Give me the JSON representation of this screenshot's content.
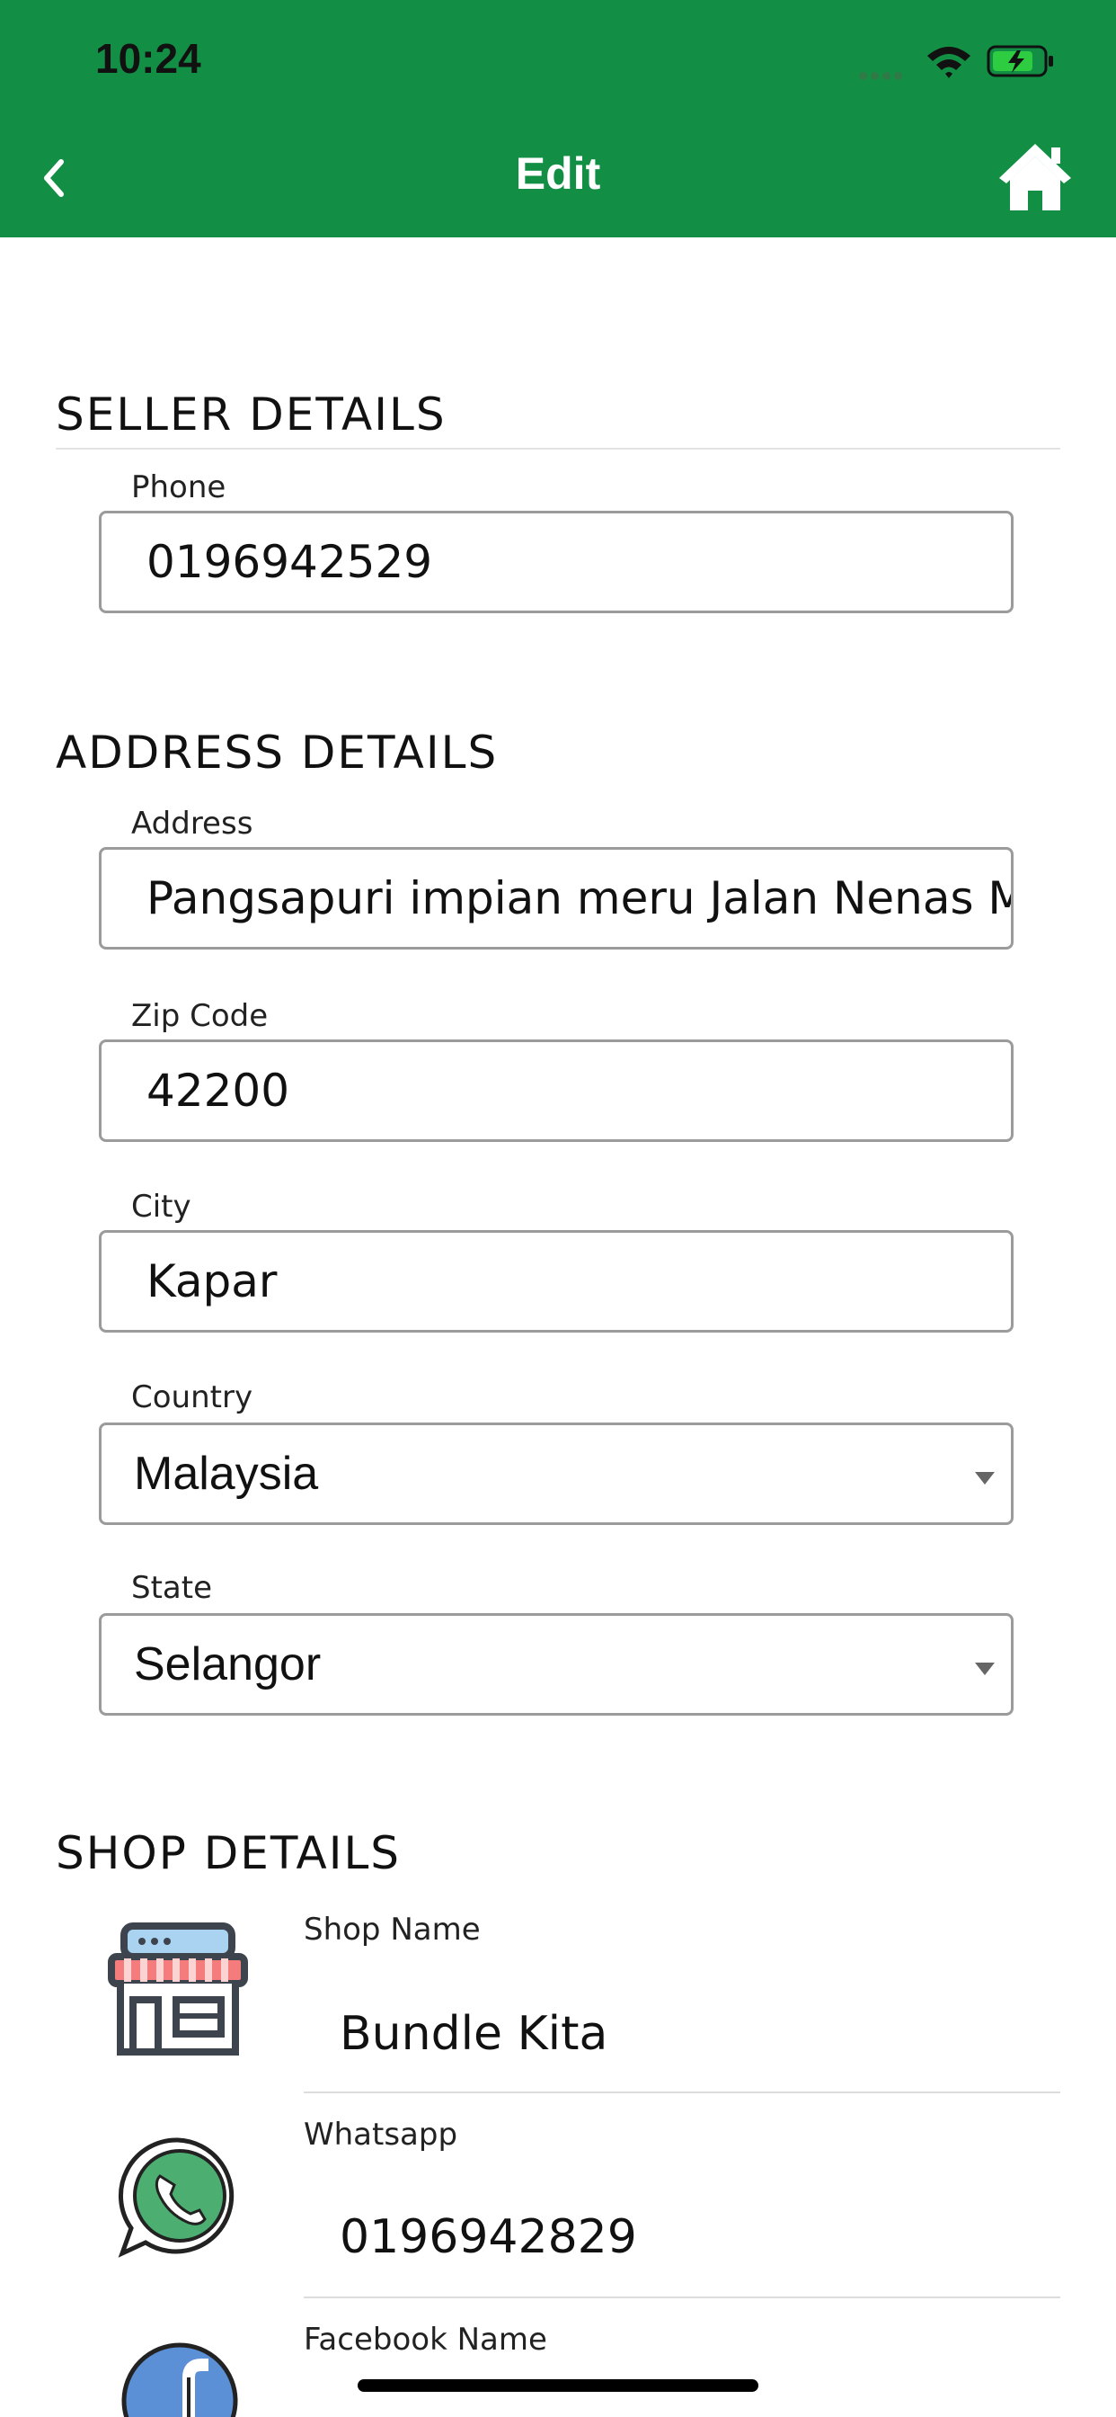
{
  "status_bar": {
    "time": "10:24"
  },
  "header": {
    "title": "Edit"
  },
  "seller": {
    "section_title": "SELLER DETAILS",
    "phone_label": "Phone",
    "phone_value": "0196942529"
  },
  "address": {
    "section_title": "ADDRESS DETAILS",
    "address_label": "Address",
    "address_value": "Pangsapuri impian meru Jalan Nenas Mac",
    "zip_label": "Zip Code",
    "zip_value": "42200",
    "city_label": "City",
    "city_value": "Kapar",
    "country_label": "Country",
    "country_value": "Malaysia",
    "state_label": "State",
    "state_value": "Selangor"
  },
  "shop": {
    "section_title": "SHOP DETAILS",
    "items": [
      {
        "label": "Shop Name",
        "value": "Bundle Kita",
        "icon": "storefront-icon"
      },
      {
        "label": "Whatsapp",
        "value": "0196942829",
        "icon": "whatsapp-icon"
      },
      {
        "label": "Facebook Name",
        "value": "",
        "icon": "facebook-icon"
      }
    ]
  },
  "colors": {
    "header": "#138f45",
    "border": "#9b9b9b"
  }
}
